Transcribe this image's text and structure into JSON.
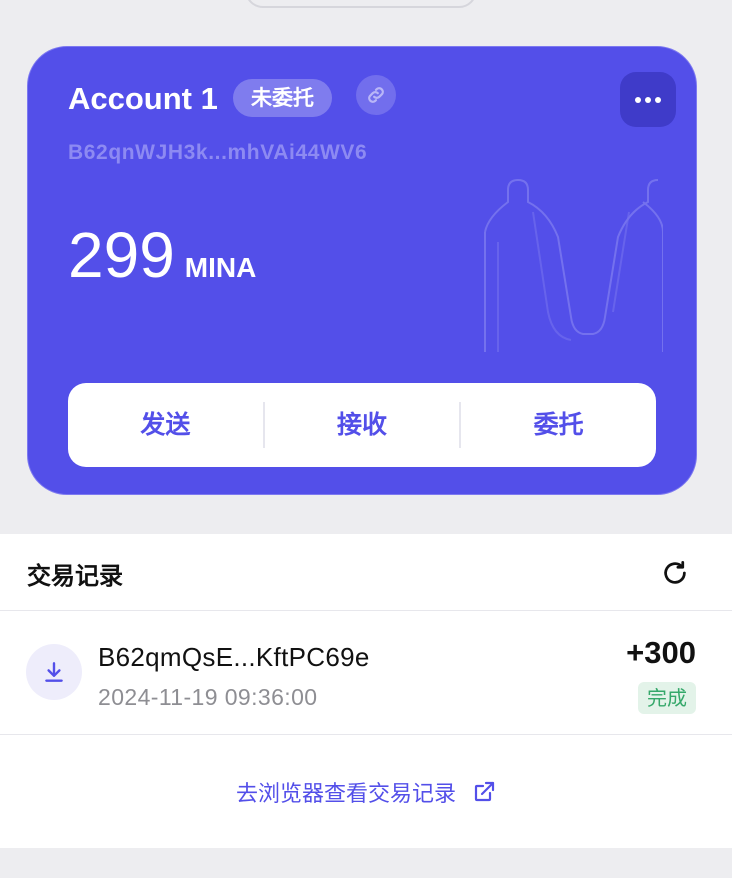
{
  "account": {
    "name": "Account 1",
    "status": "未委托",
    "address": "B62qnWJH3k...mhVAi44WV6",
    "balance": "299",
    "unit": "MINA"
  },
  "actions": {
    "send": "发送",
    "receive": "接收",
    "delegate": "委托"
  },
  "history": {
    "title": "交易记录",
    "transactions": [
      {
        "address": "B62qmQsE...KftPC69e",
        "time": "2024-11-19 09:36:00",
        "amount": "+300",
        "status": "完成",
        "icon": "download-icon"
      }
    ],
    "explorer_link": "去浏览器查看交易记录"
  },
  "colors": {
    "accent": "#534FE9",
    "background": "#EDEDF0",
    "success": "#35A86A"
  }
}
